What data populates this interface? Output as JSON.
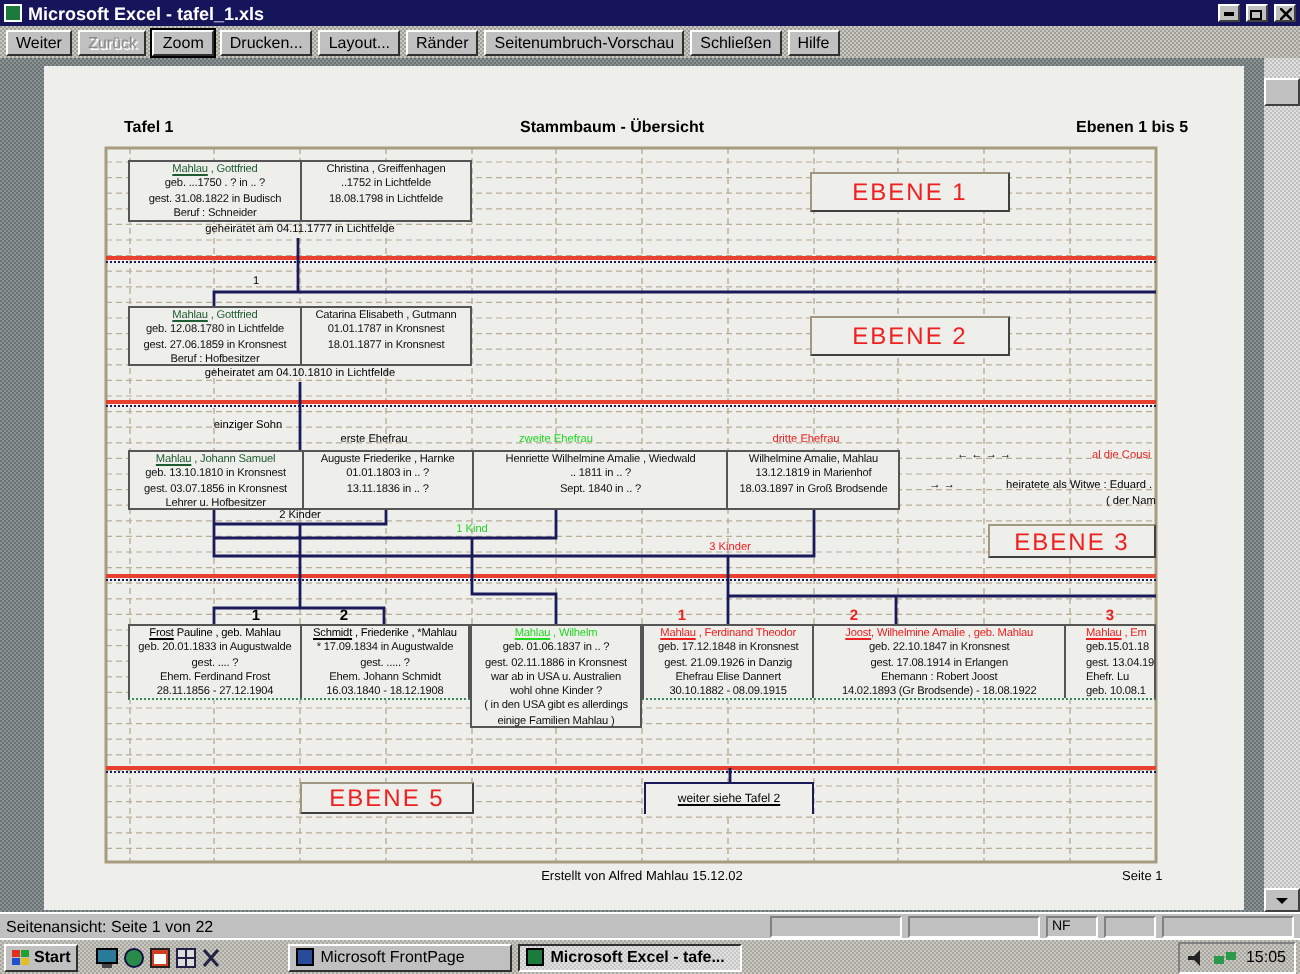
{
  "window": {
    "title": "Microsoft Excel - tafel_1.xls"
  },
  "toolbar": [
    {
      "label": "Weiter",
      "disabled": false,
      "focused": false
    },
    {
      "label": "Zurück",
      "disabled": true,
      "focused": false
    },
    {
      "label": "Zoom",
      "disabled": false,
      "focused": true
    },
    {
      "label": "Drucken...",
      "disabled": false,
      "focused": false
    },
    {
      "label": "Layout...",
      "disabled": false,
      "focused": false
    },
    {
      "label": "Ränder",
      "disabled": false,
      "focused": false
    },
    {
      "label": "Seitenumbruch-Vorschau",
      "disabled": false,
      "focused": false
    },
    {
      "label": "Schließen",
      "disabled": false,
      "focused": false
    },
    {
      "label": "Hilfe",
      "disabled": false,
      "focused": false
    }
  ],
  "sheet": {
    "header": {
      "left": "Tafel 1",
      "center": "Stammbaum - Übersicht",
      "right": "Ebenen 1 bis 5"
    },
    "levels": [
      "EBENE 1",
      "EBENE 2",
      "EBENE 3",
      "EBENE 5"
    ],
    "families": [
      {
        "columns": [
          [
            {
              "kind": "name",
              "surname": "Mahlau",
              "rest": " , Gottfried",
              "color": "#1e5a32"
            },
            {
              "kind": "text",
              "text": "geb. ...1750 . ? in .. ?"
            },
            {
              "kind": "text",
              "text": "gest. 31.08.1822 in Budisch"
            },
            {
              "kind": "text",
              "text": "Beruf : Schneider"
            }
          ],
          [
            {
              "kind": "text",
              "text": "Christina , Greiffenhagen"
            },
            {
              "kind": "text",
              "text": "..1752 in Lichtfelde"
            },
            {
              "kind": "text",
              "text": "18.08.1798 in Lichtfelde"
            }
          ]
        ]
      },
      {
        "columns": [
          [
            {
              "kind": "name",
              "surname": "Mahlau",
              "rest": " , Gottfried",
              "color": "#1e5a32"
            },
            {
              "kind": "text",
              "text": "geb. 12.08.1780 in Lichtfelde"
            },
            {
              "kind": "text",
              "text": "gest. 27.06.1859 in Kronsnest"
            },
            {
              "kind": "text",
              "text": "Beruf : Hofbesitzer"
            }
          ],
          [
            {
              "kind": "text",
              "text": "Catarina Elisabeth , Gutmann"
            },
            {
              "kind": "text",
              "text": "01.01.1787 in Kronsnest"
            },
            {
              "kind": "text",
              "text": "18.01.1877 in Kronsnest"
            }
          ]
        ]
      },
      {
        "columns": [
          [
            {
              "kind": "name",
              "surname": "Mahlau",
              "rest": " , Johann Samuel",
              "color": "#1e5a32"
            },
            {
              "kind": "text",
              "text": "geb. 13.10.1810 in Kronsnest"
            },
            {
              "kind": "text",
              "text": "gest. 03.07.1856 in Kronsnest"
            },
            {
              "kind": "text",
              "text": "Lehrer u. Hofbesitzer"
            }
          ],
          [
            {
              "kind": "text",
              "text": "Auguste Friederike , Harnke"
            },
            {
              "kind": "text",
              "text": "01.01.1803 in .. ?"
            },
            {
              "kind": "text",
              "text": "13.11.1836 in .. ?"
            }
          ],
          [
            {
              "kind": "text",
              "text": "Henriette Wilhelmine Amalie , Wiedwald"
            },
            {
              "kind": "text",
              "text": ".. 1811 in .. ?"
            },
            {
              "kind": "text",
              "text": "Sept. 1840 in .. ?"
            }
          ],
          [
            {
              "kind": "text",
              "text": "Wilhelmine Amalie, Mahlau"
            },
            {
              "kind": "text",
              "text": "13.12.1819 in Marienhof"
            },
            {
              "kind": "text",
              "text": "18.03.1897 in Groß Brodsende"
            }
          ]
        ]
      },
      {
        "columns": [
          [
            {
              "kind": "name",
              "surname": "Frost",
              "rest": " Pauline , geb. Mahlau",
              "color": "#000000"
            },
            {
              "kind": "text",
              "text": "geb. 20.01.1833 in Augustwalde"
            },
            {
              "kind": "text",
              "text": "gest. .... ?"
            },
            {
              "kind": "text",
              "text": "Ehem. Ferdinand Frost"
            },
            {
              "kind": "text",
              "text": "28.11.1856 - 27.12.1904"
            }
          ],
          [
            {
              "kind": "name",
              "surname": "Schmidt",
              "rest": " , Friederike , *Mahlau",
              "color": "#000000"
            },
            {
              "kind": "text",
              "text": "* 17.09.1834 in Augustwalde"
            },
            {
              "kind": "text",
              "text": "gest. ..... ?"
            },
            {
              "kind": "text",
              "text": "Ehem. Johann Schmidt"
            },
            {
              "kind": "text",
              "text": "16.03.1840 - 18.12.1908"
            }
          ]
        ]
      },
      {
        "columns": [
          [
            {
              "kind": "name",
              "surname": "Mahlau",
              "rest": " , Wilhelm",
              "color": "#22d822"
            },
            {
              "kind": "text",
              "text": "geb. 01.06.1837 in .. ?"
            },
            {
              "kind": "text",
              "text": "gest. 02.11.1886 in Kronsnest"
            },
            {
              "kind": "text",
              "text": "war ab in USA u. Australien"
            },
            {
              "kind": "text",
              "text": "wohl ohne Kinder ?"
            },
            {
              "kind": "text",
              "text": "( in den USA gibt es allerdings"
            },
            {
              "kind": "text",
              "text": "einige Familien Mahlau )"
            }
          ]
        ]
      },
      {
        "columns": [
          [
            {
              "kind": "name",
              "surname": "Mahlau",
              "rest": " , Ferdinand Theodor",
              "color": "#ee2020"
            },
            {
              "kind": "text",
              "text": "geb. 17.12.1848 in Kronsnest"
            },
            {
              "kind": "text",
              "text": "gest. 21.09.1926 in Danzig"
            },
            {
              "kind": "text",
              "text": "Ehefrau Elise Dannert"
            },
            {
              "kind": "text",
              "text": "30.10.1882 - 08.09.1915"
            }
          ],
          [
            {
              "kind": "name",
              "surname": "Joost",
              "rest": ", Wilhelmine Amalie , geb. Mahlau",
              "color": "#ee2020"
            },
            {
              "kind": "text",
              "text": "geb. 22.10.1847 in Kronsnest"
            },
            {
              "kind": "text",
              "text": "gest. 17.08.1914 in Erlangen"
            },
            {
              "kind": "text",
              "text": "Ehemann : Robert Joost"
            },
            {
              "kind": "text",
              "text": "14.02.1893 (Gr Brodsende) - 18.08.1922"
            }
          ],
          [
            {
              "kind": "name",
              "surname": "Mahlau",
              "rest": " , Em",
              "color": "#ee2020"
            },
            {
              "kind": "text",
              "text": "geb.15.01.18"
            },
            {
              "kind": "text",
              "text": "gest. 13.04.19"
            },
            {
              "kind": "text",
              "text": "Ehefr. Lu"
            },
            {
              "kind": "text",
              "text": "geb. 10.08.1"
            }
          ]
        ]
      }
    ],
    "notes": [
      {
        "text": "geheiratet am 04.11.1777 in Lichtfelde",
        "color": "#000000"
      },
      {
        "text": "1"
      },
      {
        "text": "geheiratet am 04.10.1810 in Lichtfelde",
        "color": "#000000"
      },
      {
        "text": "einziger Sohn",
        "color": "#000000"
      },
      {
        "text": "erste Ehefrau",
        "color": "#000000"
      },
      {
        "text": "zweite Ehefrau",
        "color": "#22d822"
      },
      {
        "text": "dritte Ehefrau",
        "color": "#ee2020"
      },
      {
        "text": "←  ←  →  →"
      },
      {
        "text": "al die Cousi",
        "color": "#ee2020"
      },
      {
        "text": "→      →"
      },
      {
        "text": "heiratete als Witwe : Eduard .",
        "color": "#000000"
      },
      {
        "text": "( der Nam",
        "color": "#000000"
      },
      {
        "text": "2 Kinder",
        "color": "#000000"
      },
      {
        "text": "1 Kind",
        "color": "#22d822"
      },
      {
        "text": "3 Kinder",
        "color": "#ee2020"
      },
      {
        "text": "1"
      },
      {
        "text": "2"
      },
      {
        "text": "1",
        "color": "#ee2020"
      },
      {
        "text": "2",
        "color": "#ee2020"
      },
      {
        "text": "3",
        "color": "#ee2020"
      }
    ],
    "link": "weiter siehe Tafel 2",
    "footer": {
      "center": "Erstellt von Alfred Mahlau 15.12.02",
      "right": "Seite 1"
    }
  },
  "status_bar": {
    "text": "Seitenansicht: Seite 1 von 22",
    "indicator": "NF"
  },
  "taskbar": {
    "start": "Start",
    "tasks": [
      {
        "label": "Microsoft FrontPage",
        "selected": false
      },
      {
        "label": "Microsoft Excel - tafe...",
        "selected": true
      }
    ],
    "clock": "15:05"
  }
}
